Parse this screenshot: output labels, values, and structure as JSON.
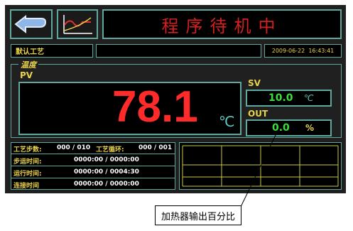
{
  "header": {
    "title": "程序待机中",
    "back_icon": "back-arrow-icon",
    "curve_icon": "curve-chart-icon"
  },
  "status_bar": {
    "process_name": "默认工艺",
    "middle_text": "",
    "datetime": "2009-06-22  16:43:41"
  },
  "temperature": {
    "group_label": "温度",
    "pv_label": "PV",
    "pv_value": "78.1",
    "pv_unit": "℃",
    "sv_label": "SV",
    "sv_value": "10.0",
    "sv_unit": "℃",
    "out_label": "OUT",
    "out_value": "0.0",
    "out_unit": "%"
  },
  "info": {
    "step_label": "工艺步数:",
    "step_value": "000 / 010",
    "cycle_label": "工艺循环:",
    "cycle_value": "000 / 001",
    "step_time_label": "步运时间:",
    "step_time_value": "0000:00 / 0000:00",
    "run_time_label": "运行时间:",
    "run_time_value": "0000:00 / 0004:30",
    "link_time_label": "连接时间",
    "link_time_value": "0000:00 / 0000:00"
  },
  "annotation": {
    "text": "加热器输出百分比"
  },
  "colors": {
    "pv_red": "#ff2a2a",
    "value_green": "#3ddc3d",
    "label_yellow": "#e8d24a",
    "frame_teal": "#5fa89e",
    "title_red": "#d42020"
  }
}
